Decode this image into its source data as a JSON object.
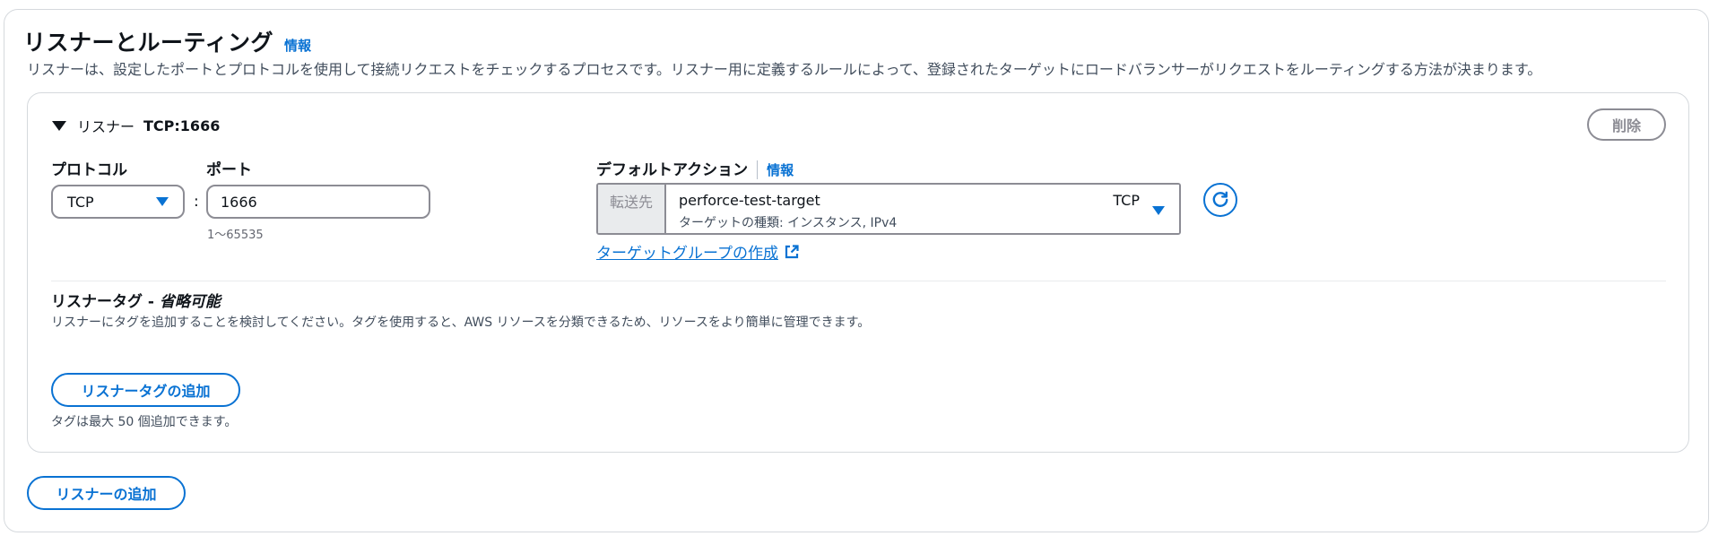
{
  "section": {
    "title": "リスナーとルーティング",
    "info_label": "情報",
    "description": "リスナーは、設定したポートとプロトコルを使用して接続リクエストをチェックするプロセスです。リスナー用に定義するルールによって、登録されたターゲットにロードバランサーがリクエストをルーティングする方法が決まります。"
  },
  "listener": {
    "prefix": "リスナー",
    "name": "TCP:1666",
    "delete_label": "削除",
    "protocol_label": "プロトコル",
    "protocol_value": "TCP",
    "port_label": "ポート",
    "port_value": "1666",
    "port_hint": "1〜65535",
    "separator": ":",
    "default_action_label": "デフォルトアクション",
    "default_action_info": "情報",
    "forward_addon": "転送先",
    "target_name": "perforce-test-target",
    "target_protocol": "TCP",
    "target_subtitle": "ターゲットの種類: インスタンス, IPv4",
    "create_target_group_link": "ターゲットグループの作成",
    "tags_title": "リスナータグ - ",
    "tags_optional": "省略可能",
    "tags_description": "リスナーにタグを追加することを検討してください。タグを使用すると、AWS リソースを分類できるため、リソースをより簡単に管理できます。",
    "add_tag_button": "リスナータグの追加",
    "tags_limit": "タグは最大 50 個追加できます。"
  },
  "add_listener_button": "リスナーの追加",
  "colors": {
    "accent": "#0972d3",
    "border": "#8c8c94",
    "panel_border": "#d5d9dd",
    "addon_bg": "#e9ebed"
  },
  "icons": {
    "caret": "caret-down-filled-icon",
    "select": "triangle-down-icon",
    "refresh": "refresh-icon",
    "external": "external-link-icon"
  }
}
